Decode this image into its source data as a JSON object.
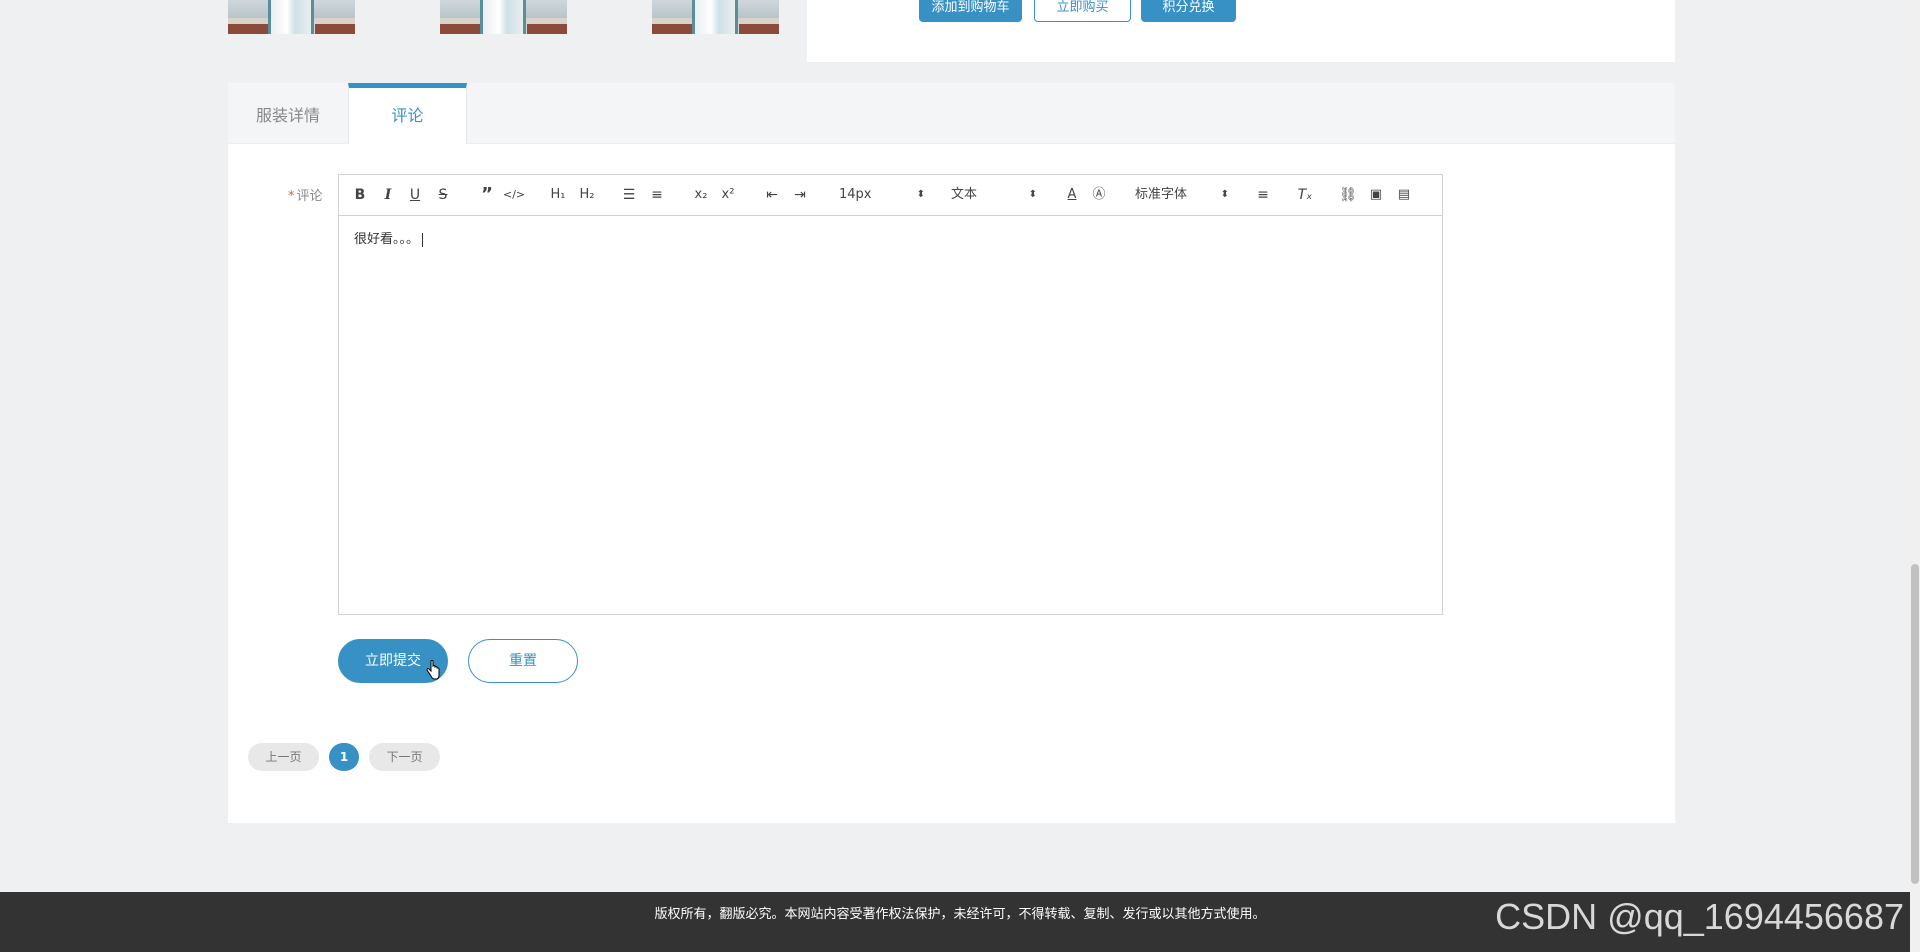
{
  "top": {
    "btn_cart": "添加到购物车",
    "btn_buy": "立即购买",
    "btn_points": "积分兑换"
  },
  "tabs": [
    {
      "label": "服装详情",
      "active": false
    },
    {
      "label": "评论",
      "active": true
    }
  ],
  "form": {
    "comment_label": "评论",
    "required_mark": "*",
    "editor": {
      "font_size": "14px",
      "text_style": "文本",
      "font_family": "标准字体",
      "content": "很好看。。。"
    },
    "submit_label": "立即提交",
    "reset_label": "重置"
  },
  "pager": {
    "prev": "上一页",
    "current": "1",
    "next": "下一页"
  },
  "footer": {
    "text": "版权所有，翻版必究。本网站内容受著作权法保护，未经许可，不得转载、复制、发行或以其他方式使用。",
    "watermark": "CSDN @qq_1694456687"
  },
  "colors": {
    "accent": "#3791c4",
    "footer_bg": "#333333",
    "page_bg": "#eef0f2"
  },
  "toolbar_icons": [
    "bold-icon",
    "italic-icon",
    "underline-icon",
    "strike-icon",
    "blockquote-icon",
    "code-block-icon",
    "h1-icon",
    "h2-icon",
    "ordered-list-icon",
    "bullet-list-icon",
    "subscript-icon",
    "superscript-icon",
    "outdent-icon",
    "indent-icon",
    "font-color-icon",
    "background-color-icon",
    "align-icon",
    "clear-format-icon",
    "link-icon",
    "image-icon",
    "video-icon"
  ]
}
